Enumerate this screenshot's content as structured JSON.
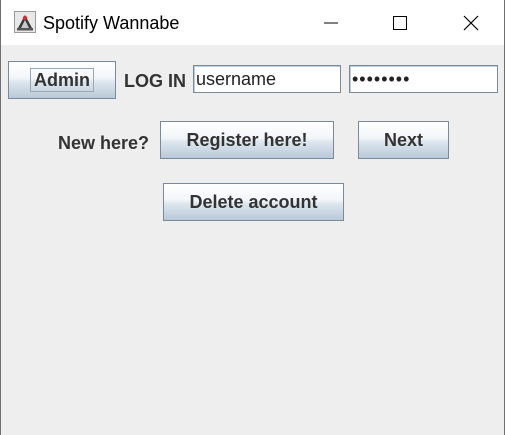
{
  "window": {
    "title": "Spotify Wannabe",
    "app_icon": "java-cup-icon",
    "controls": {
      "minimize_icon": "minimize-icon",
      "maximize_icon": "maximize-icon",
      "close_icon": "close-icon"
    }
  },
  "login": {
    "admin_label": "Admin",
    "login_label": "LOG IN",
    "username_value": "username",
    "password_value": "••••••••"
  },
  "register": {
    "prompt_label": "New here?",
    "register_label": "Register here!",
    "next_label": "Next"
  },
  "account": {
    "delete_label": "Delete account"
  },
  "colors": {
    "background": "#eeeeee",
    "titlebar": "#ffffff",
    "button_text": "#333333",
    "field_border": "#7a8a99"
  }
}
